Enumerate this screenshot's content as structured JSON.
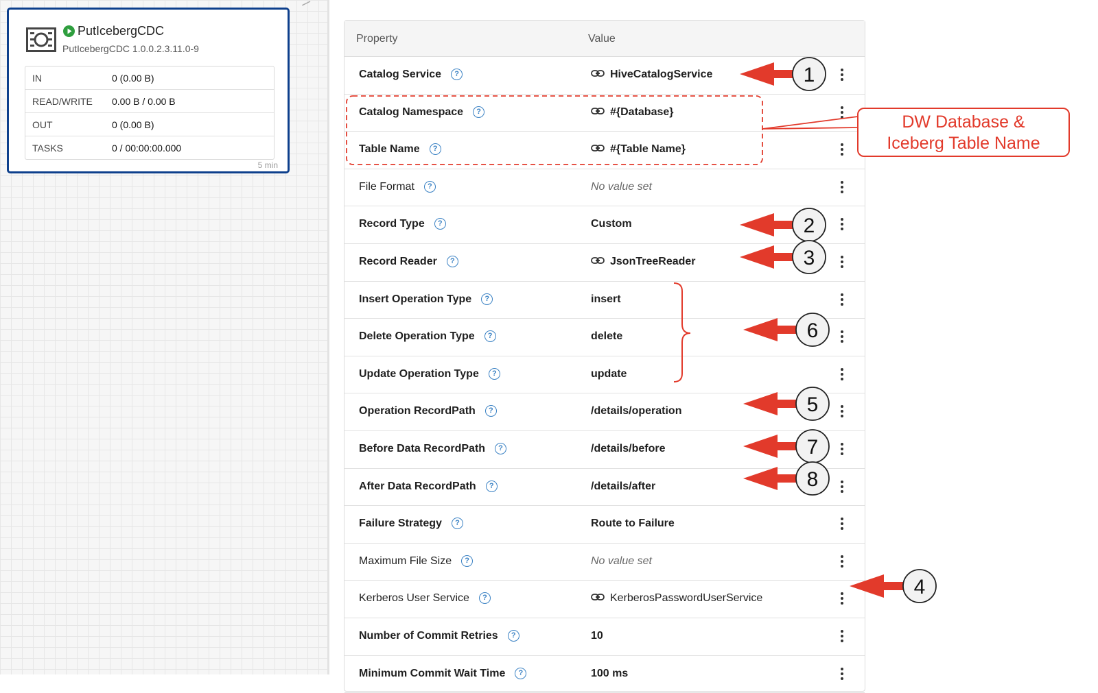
{
  "processor": {
    "name": "PutIcebergCDC",
    "version": "PutIcebergCDC 1.0.0.2.3.11.0-9",
    "stats": [
      {
        "label": "IN",
        "value": "0 (0.00 B)"
      },
      {
        "label": "READ/WRITE",
        "value": "0.00 B / 0.00 B"
      },
      {
        "label": "OUT",
        "value": "0 (0.00 B)"
      },
      {
        "label": "TASKS",
        "value": "0 / 00:00:00.000"
      }
    ],
    "time_window": "5 min"
  },
  "table": {
    "header_property": "Property",
    "header_value": "Value",
    "rows": [
      {
        "name": "Catalog Service",
        "value": "HiveCatalogService",
        "link": true,
        "bold": true
      },
      {
        "name": "Catalog Namespace",
        "value": "#{Database}",
        "link": true,
        "bold": true
      },
      {
        "name": "Table Name",
        "value": "#{Table Name}",
        "link": true,
        "bold": true
      },
      {
        "name": "File Format",
        "value": "No value set",
        "link": false,
        "bold": false,
        "unset": true
      },
      {
        "name": "Record Type",
        "value": "Custom",
        "link": false,
        "bold": true
      },
      {
        "name": "Record Reader",
        "value": "JsonTreeReader",
        "link": true,
        "bold": true
      },
      {
        "name": "Insert Operation Type",
        "value": "insert",
        "link": false,
        "bold": true
      },
      {
        "name": "Delete Operation Type",
        "value": "delete",
        "link": false,
        "bold": true
      },
      {
        "name": "Update Operation Type",
        "value": "update",
        "link": false,
        "bold": true
      },
      {
        "name": "Operation RecordPath",
        "value": "/details/operation",
        "link": false,
        "bold": true
      },
      {
        "name": "Before Data RecordPath",
        "value": "/details/before",
        "link": false,
        "bold": true
      },
      {
        "name": "After Data RecordPath",
        "value": "/details/after",
        "link": false,
        "bold": true
      },
      {
        "name": "Failure Strategy",
        "value": "Route to Failure",
        "link": false,
        "bold": true
      },
      {
        "name": "Maximum File Size",
        "value": "No value set",
        "link": false,
        "bold": false,
        "unset": true
      },
      {
        "name": "Kerberos User Service",
        "value": "KerberosPasswordUserService",
        "link": true,
        "bold": false
      },
      {
        "name": "Number of Commit Retries",
        "value": "10",
        "link": false,
        "bold": true
      },
      {
        "name": "Minimum Commit Wait Time",
        "value": "100 ms",
        "link": false,
        "bold": true
      }
    ]
  },
  "annotations": {
    "callout_line1": "DW Database &",
    "callout_line2": "Iceberg Table Name",
    "markers": [
      "1",
      "2",
      "3",
      "6",
      "5",
      "7",
      "8",
      "4"
    ],
    "color": "#e23a2b"
  },
  "colors": {
    "card_border": "#0d3f8c",
    "running": "#2e9e3e",
    "help_icon": "#3b82c4"
  }
}
